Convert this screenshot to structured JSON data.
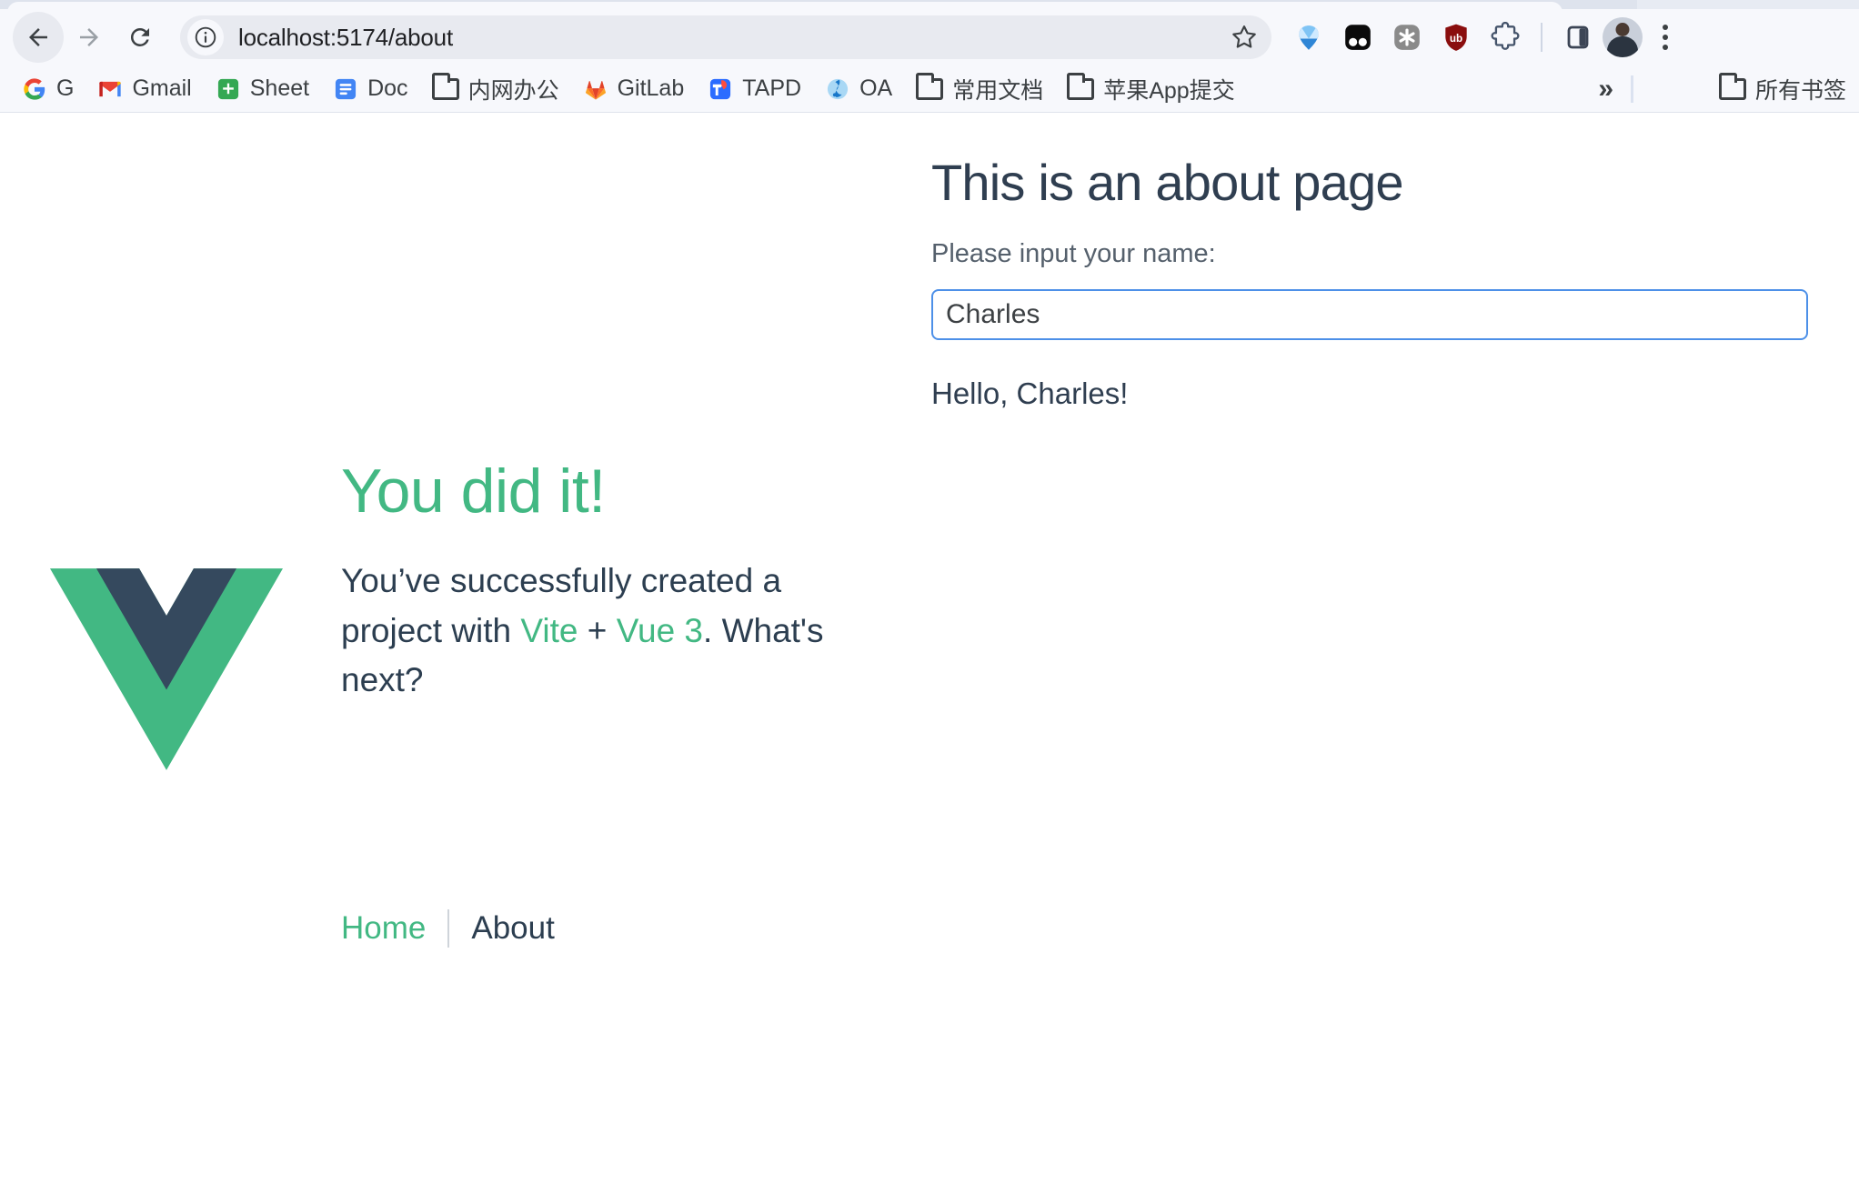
{
  "browser": {
    "nav": {
      "back_label": "Back",
      "forward_label": "Forward",
      "reload_label": "Reload"
    },
    "omnibox": {
      "url": "localhost:5174/about",
      "info_icon": "site-information-icon",
      "star_icon": "bookmark-star-icon"
    },
    "extensions": [
      {
        "name": "blue-gem-extension-icon"
      },
      {
        "name": "black-rounded-square-extension-icon"
      },
      {
        "name": "asterisk-extension-icon"
      },
      {
        "name": "ublock-origin-shield-icon"
      },
      {
        "name": "extensions-puzzle-icon"
      },
      {
        "name": "side-panel-icon"
      }
    ],
    "profile_label": "Profile",
    "menu_label": "Customize and control Google Chrome"
  },
  "bookmarks": {
    "items": [
      {
        "label": "G",
        "icon": "google-icon"
      },
      {
        "label": "Gmail",
        "icon": "gmail-icon"
      },
      {
        "label": "Sheet",
        "icon": "google-sheets-icon"
      },
      {
        "label": "Doc",
        "icon": "google-docs-icon"
      },
      {
        "label": "内网办公",
        "icon": "folder-icon"
      },
      {
        "label": "GitLab",
        "icon": "gitlab-icon"
      },
      {
        "label": "TAPD",
        "icon": "tapd-icon"
      },
      {
        "label": "OA",
        "icon": "oa-icon"
      },
      {
        "label": "常用文档",
        "icon": "folder-icon"
      },
      {
        "label": "苹果App提交",
        "icon": "folder-icon"
      }
    ],
    "overflow_label": "»",
    "all_bookmarks_label": "所有书签"
  },
  "page": {
    "hero": {
      "heading": "You did it!",
      "body_part1": "You’ve successfully created a project with ",
      "link_vite": "Vite",
      "plus": " + ",
      "link_vue": "Vue 3",
      "body_part2": ". What's next?",
      "logo_name": "vue-logo"
    },
    "nav": {
      "home_label": "Home",
      "about_label": "About"
    },
    "about": {
      "heading": "This is an about page",
      "input_label": "Please input your name:",
      "input_value": "Charles",
      "input_placeholder": "",
      "greeting": "Hello, Charles!"
    }
  },
  "colors": {
    "vue_green": "#42b883",
    "vue_navy": "#35495e",
    "text_dark": "#2c3e50",
    "focus_blue": "#4d90e8"
  }
}
